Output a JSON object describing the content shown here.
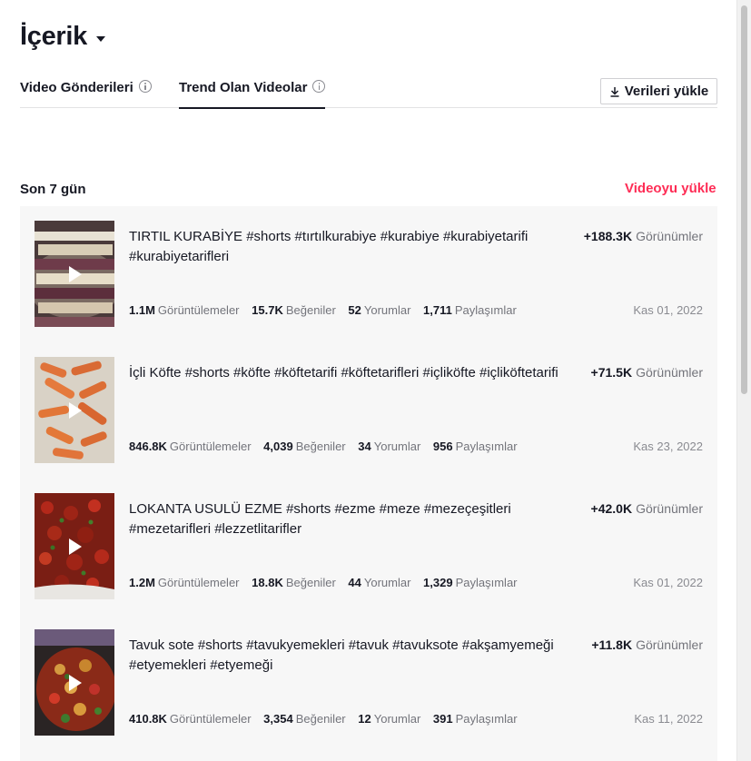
{
  "header": {
    "title": "İçerik"
  },
  "tabs": [
    {
      "label": "Video Gönderileri",
      "active": false
    },
    {
      "label": "Trend Olan Videolar",
      "active": true
    }
  ],
  "download_button": {
    "label": "Verileri yükle",
    "icon": "download-icon"
  },
  "section": {
    "period_label": "Son 7 gün",
    "upload_link": "Videoyu yükle"
  },
  "colors": {
    "accent": "#fe2c55",
    "text": "#161823",
    "muted": "#73747b",
    "list_bg": "#f7f7f7"
  },
  "videos": [
    {
      "title": "TIRTIL KURABİYE #shorts #tırtılkurabiye #kurabiye #kurabiyetarifi #kurabiyetarifleri",
      "views_delta": "+188.3K",
      "views_delta_label": "Görünümler",
      "views": "1.1M",
      "views_label": "Görüntülemeler",
      "likes": "15.7K",
      "likes_label": "Beğeniler",
      "comments": "52",
      "comments_label": "Yorumlar",
      "shares": "1,711",
      "shares_label": "Paylaşımlar",
      "date": "Kas 01, 2022"
    },
    {
      "title": "İçli Köfte #shorts #köfte #köftetarifi #köftetarifleri #içliköfte #içliköftetarifi",
      "views_delta": "+71.5K",
      "views_delta_label": "Görünümler",
      "views": "846.8K",
      "views_label": "Görüntülemeler",
      "likes": "4,039",
      "likes_label": "Beğeniler",
      "comments": "34",
      "comments_label": "Yorumlar",
      "shares": "956",
      "shares_label": "Paylaşımlar",
      "date": "Kas 23, 2022"
    },
    {
      "title": "LOKANTA USULÜ EZME #shorts #ezme #meze #mezeçeşitleri #mezetarifleri #lezzetlitarifler",
      "views_delta": "+42.0K",
      "views_delta_label": "Görünümler",
      "views": "1.2M",
      "views_label": "Görüntülemeler",
      "likes": "18.8K",
      "likes_label": "Beğeniler",
      "comments": "44",
      "comments_label": "Yorumlar",
      "shares": "1,329",
      "shares_label": "Paylaşımlar",
      "date": "Kas 01, 2022"
    },
    {
      "title": "Tavuk sote #shorts #tavukyemekleri #tavuk #tavuksote #akşamyemeği #etyemekleri #etyemeği",
      "views_delta": "+11.8K",
      "views_delta_label": "Görünümler",
      "views": "410.8K",
      "views_label": "Görüntülemeler",
      "likes": "3,354",
      "likes_label": "Beğeniler",
      "comments": "12",
      "comments_label": "Yorumlar",
      "shares": "391",
      "shares_label": "Paylaşımlar",
      "date": "Kas 11, 2022"
    }
  ]
}
